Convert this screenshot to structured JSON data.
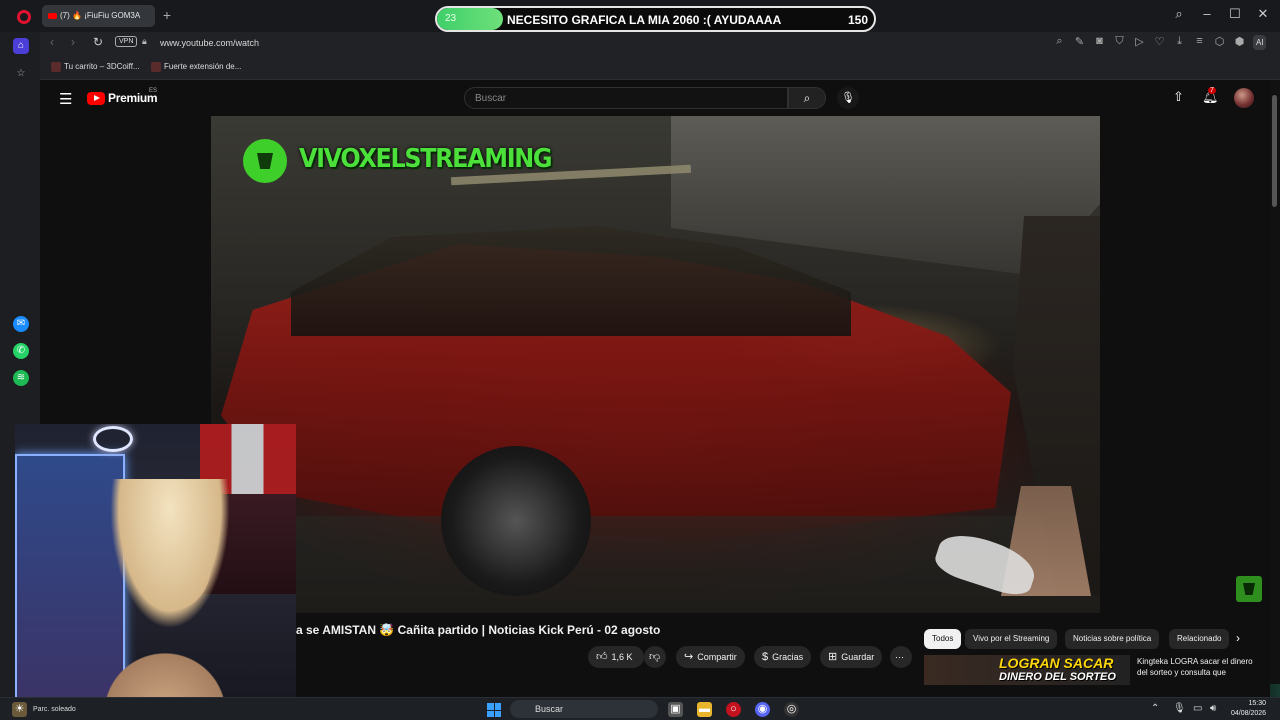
{
  "browser": {
    "tab": {
      "title": "(7) 🔥 ¡FiuFiu GOM3A",
      "count": "7"
    },
    "url": "www.youtube.com/watch",
    "vpn": "VPN",
    "ai_label": "AI",
    "bookmarks": [
      {
        "label": "Tu carrito – 3DCoiff..."
      },
      {
        "label": "Fuerte extensión de..."
      }
    ]
  },
  "overlay": {
    "left_value": "23",
    "message": "NECESITO GRAFICA LA MIA 2060 :( AYUDAAAA",
    "right_value": "150",
    "progress_fraction": 0.15
  },
  "youtube": {
    "brand": "Premium",
    "region": "ES",
    "search_placeholder": "Buscar",
    "notifications": "7"
  },
  "video": {
    "channel_overlay": "VIVOXELSTREAMING",
    "title": "a se AMISTAN 🤯 Cañita partido | Noticias Kick Perú - 02 agosto",
    "likes": "1,6 K",
    "share": "Compartir",
    "thanks": "Gracias",
    "save": "Guardar"
  },
  "recommendations": {
    "chips": [
      "Todos",
      "Vivo por el Streaming",
      "Noticias sobre política",
      "Relacionado"
    ],
    "first": {
      "thumb_text_1": "LOGRAN SACAR",
      "thumb_text_2": "DINERO DEL SORTEO",
      "title": "Kingteka LOGRA sacar el dinero del sorteo y consulta que"
    }
  },
  "taskbar": {
    "weather": "Parc. soleado",
    "search": "Buscar",
    "time": "15:30",
    "date": "04/08/2026"
  }
}
